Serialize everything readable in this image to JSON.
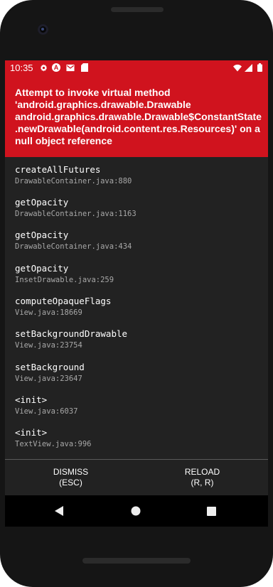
{
  "statusbar": {
    "time": "10:35",
    "icons": [
      "gear-icon",
      "a-badge-icon",
      "mail-icon",
      "sd-card-icon"
    ],
    "right_icons": [
      "wifi-icon",
      "signal-icon",
      "battery-icon"
    ]
  },
  "error": {
    "message": "Attempt to invoke virtual method 'android.graphics.drawable.Drawable android.graphics.drawable.Drawable$ConstantState .newDrawable(android.content.res.Resources)' on a null object reference"
  },
  "stack": [
    {
      "method": "createAllFutures",
      "location": "DrawableContainer.java:880"
    },
    {
      "method": "getOpacity",
      "location": "DrawableContainer.java:1163"
    },
    {
      "method": "getOpacity",
      "location": "DrawableContainer.java:434"
    },
    {
      "method": "getOpacity",
      "location": "InsetDrawable.java:259"
    },
    {
      "method": "computeOpaqueFlags",
      "location": "View.java:18669"
    },
    {
      "method": "setBackgroundDrawable",
      "location": "View.java:23754"
    },
    {
      "method": "setBackground",
      "location": "View.java:23647"
    },
    {
      "method": "<init>",
      "location": "View.java:6037"
    },
    {
      "method": "<init>",
      "location": "TextView.java:996"
    }
  ],
  "actions": {
    "dismiss_label": "DISMISS",
    "dismiss_shortcut": "(ESC)",
    "reload_label": "RELOAD",
    "reload_shortcut": "(R, R)"
  },
  "navbar": {
    "icons": [
      "back-icon",
      "home-icon",
      "recents-icon"
    ]
  },
  "colors": {
    "error_red": "#d0131e",
    "background": "#222222",
    "navbar": "#000000"
  }
}
